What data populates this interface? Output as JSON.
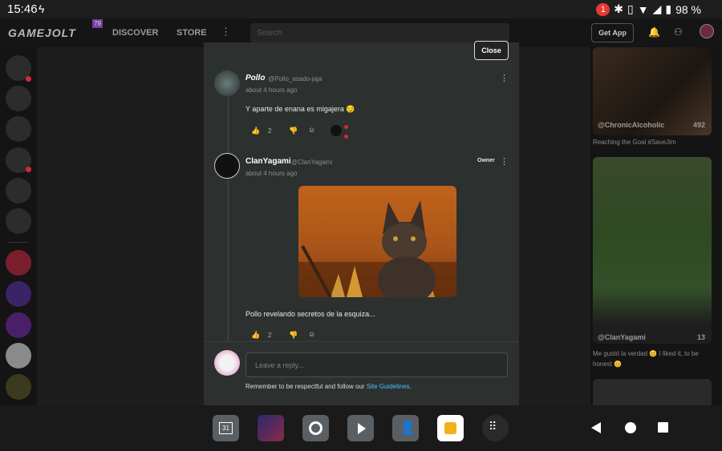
{
  "status_bar": {
    "time": "15:46",
    "notification_count": "1",
    "battery": "98 %"
  },
  "topnav": {
    "logo": "GAMEJOLT",
    "logo_badge": "79",
    "discover": "DISCOVER",
    "store": "STORE",
    "more": "⋮",
    "search_placeholder": "Search",
    "get_app": "Get App"
  },
  "modal": {
    "close_label": "Close",
    "comments": [
      {
        "name": "Pollo",
        "handle": "@Pollo_asado-jaja",
        "time": "about 4 hours ago",
        "text": "Y aparte de enana es migajera 😏",
        "likes": "2"
      },
      {
        "name": "ClanYagami",
        "handle": "@ClanYagami",
        "badge": "Owner",
        "time": "about 4 hours ago",
        "text": "Pollo revelando secretos de la esquiza...",
        "likes": "2"
      }
    ],
    "reply_placeholder": "Leave a reply...",
    "guidelines_prefix": "Remember to be respectful and follow our ",
    "guidelines_link": "Site Guidelines",
    "guidelines_suffix": "."
  },
  "right_panel": {
    "cards": [
      {
        "user": "@ChronicAlcoholic",
        "likes": "492",
        "caption": "Reaching the Goal #SaveJim"
      },
      {
        "user": "@ClanYagami",
        "likes": "13",
        "caption": "Me gustó la verdad 😊 I liked it, to be honest 😊"
      }
    ]
  },
  "taskbar": {
    "apps": [
      "calendar-app",
      "game-app",
      "chrome-app",
      "youtube-app",
      "contacts-app",
      "gamejolt-app",
      "app-drawer"
    ],
    "calendar_day": "31"
  },
  "colors": {
    "link": "#45c1ff",
    "notification_dot": "#d9263f",
    "modal_bg": "#2c302f"
  }
}
